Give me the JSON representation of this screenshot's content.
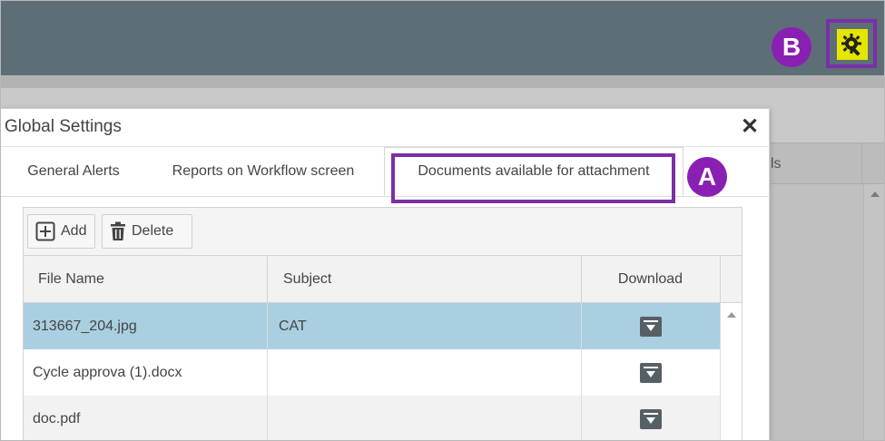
{
  "annotations": {
    "badge_a": "A",
    "badge_b": "B"
  },
  "background": {
    "column_fragment": "ls"
  },
  "dialog": {
    "title": "Global Settings",
    "close_symbol": "✕",
    "tabs": [
      {
        "label": "General Alerts",
        "active": false
      },
      {
        "label": "Reports on Workflow screen",
        "active": false
      },
      {
        "label": "Documents available for attachment",
        "active": true
      }
    ],
    "toolbar": {
      "add_label": "Add",
      "delete_label": "Delete"
    },
    "table": {
      "headers": {
        "file_name": "File Name",
        "subject": "Subject",
        "download": "Download"
      },
      "rows": [
        {
          "file_name": "313667_204.jpg",
          "subject": "CAT",
          "selected": true
        },
        {
          "file_name": "Cycle approva (1).docx",
          "subject": "",
          "selected": false
        },
        {
          "file_name": "doc.pdf",
          "subject": "",
          "selected": false
        }
      ]
    }
  },
  "colors": {
    "topbar": "#5e6e77",
    "annotation_purple": "#7b2fa6",
    "badge_purple": "#8a1fb3",
    "selected_row": "#a9cfe0",
    "gear_highlight": "#e6e600"
  },
  "icons": {
    "settings": "gear-wrench-icon",
    "add": "plus-box-icon",
    "delete": "trash-icon",
    "download": "download-icon",
    "close": "close-icon"
  }
}
